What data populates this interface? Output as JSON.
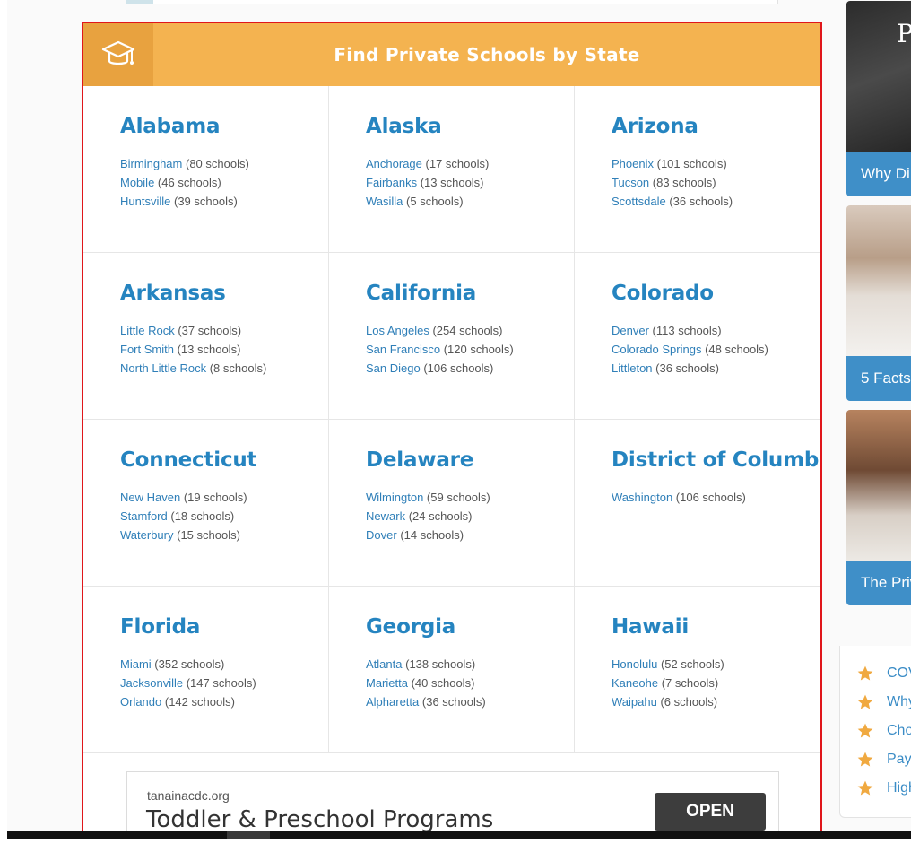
{
  "header": {
    "title": "Find Private Schools by State",
    "icon": "graduation-cap-icon"
  },
  "states": [
    {
      "name": "Alabama",
      "cities": [
        {
          "name": "Birmingham",
          "count": "(80 schools)"
        },
        {
          "name": "Mobile",
          "count": "(46 schools)"
        },
        {
          "name": "Huntsville",
          "count": "(39 schools)"
        }
      ]
    },
    {
      "name": "Alaska",
      "cities": [
        {
          "name": "Anchorage",
          "count": "(17 schools)"
        },
        {
          "name": "Fairbanks",
          "count": "(13 schools)"
        },
        {
          "name": "Wasilla",
          "count": "(5 schools)"
        }
      ]
    },
    {
      "name": "Arizona",
      "cities": [
        {
          "name": "Phoenix",
          "count": "(101 schools)"
        },
        {
          "name": "Tucson",
          "count": "(83 schools)"
        },
        {
          "name": "Scottsdale",
          "count": "(36 schools)"
        }
      ]
    },
    {
      "name": "Arkansas",
      "cities": [
        {
          "name": "Little Rock",
          "count": "(37 schools)"
        },
        {
          "name": "Fort Smith",
          "count": "(13 schools)"
        },
        {
          "name": "North Little Rock",
          "count": "(8 schools)"
        }
      ]
    },
    {
      "name": "California",
      "cities": [
        {
          "name": "Los Angeles",
          "count": "(254 schools)"
        },
        {
          "name": "San Francisco",
          "count": "(120 schools)"
        },
        {
          "name": "San Diego",
          "count": "(106 schools)"
        }
      ]
    },
    {
      "name": "Colorado",
      "cities": [
        {
          "name": "Denver",
          "count": "(113 schools)"
        },
        {
          "name": "Colorado Springs",
          "count": "(48 schools)"
        },
        {
          "name": "Littleton",
          "count": "(36 schools)"
        }
      ]
    },
    {
      "name": "Connecticut",
      "cities": [
        {
          "name": "New Haven",
          "count": "(19 schools)"
        },
        {
          "name": "Stamford",
          "count": "(18 schools)"
        },
        {
          "name": "Waterbury",
          "count": "(15 schools)"
        }
      ]
    },
    {
      "name": "Delaware",
      "cities": [
        {
          "name": "Wilmington",
          "count": "(59 schools)"
        },
        {
          "name": "Newark",
          "count": "(24 schools)"
        },
        {
          "name": "Dover",
          "count": "(14 schools)"
        }
      ]
    },
    {
      "name": "District of Columbia",
      "cities": [
        {
          "name": "Washington",
          "count": "(106 schools)"
        }
      ]
    },
    {
      "name": "Florida",
      "cities": [
        {
          "name": "Miami",
          "count": "(352 schools)"
        },
        {
          "name": "Jacksonville",
          "count": "(147 schools)"
        },
        {
          "name": "Orlando",
          "count": "(142 schools)"
        }
      ]
    },
    {
      "name": "Georgia",
      "cities": [
        {
          "name": "Atlanta",
          "count": "(138 schools)"
        },
        {
          "name": "Marietta",
          "count": "(40 schools)"
        },
        {
          "name": "Alpharetta",
          "count": "(36 schools)"
        }
      ]
    },
    {
      "name": "Hawaii",
      "cities": [
        {
          "name": "Honolulu",
          "count": "(52 schools)"
        },
        {
          "name": "Kaneohe",
          "count": "(7 schools)"
        },
        {
          "name": "Waipahu",
          "count": "(6 schools)"
        }
      ]
    }
  ],
  "ad": {
    "domain": "tanainacdc.org",
    "headline": "Toddler & Preschool Programs",
    "button": "OPEN"
  },
  "sidebar": {
    "cards": [
      {
        "chalk": "P",
        "caption": "Why Di"
      },
      {
        "caption": "5 Facts"
      },
      {
        "caption": "The Priv"
      }
    ],
    "links": [
      "COV",
      "Why",
      "Cho",
      "Payi",
      "High"
    ]
  },
  "colors": {
    "header": "#f4b350",
    "header_icon_bg": "#e8a23f",
    "state_link": "#2584c0",
    "frame": "#e0161b",
    "card_caption": "#3f8fc8",
    "star": "#f0a940"
  }
}
